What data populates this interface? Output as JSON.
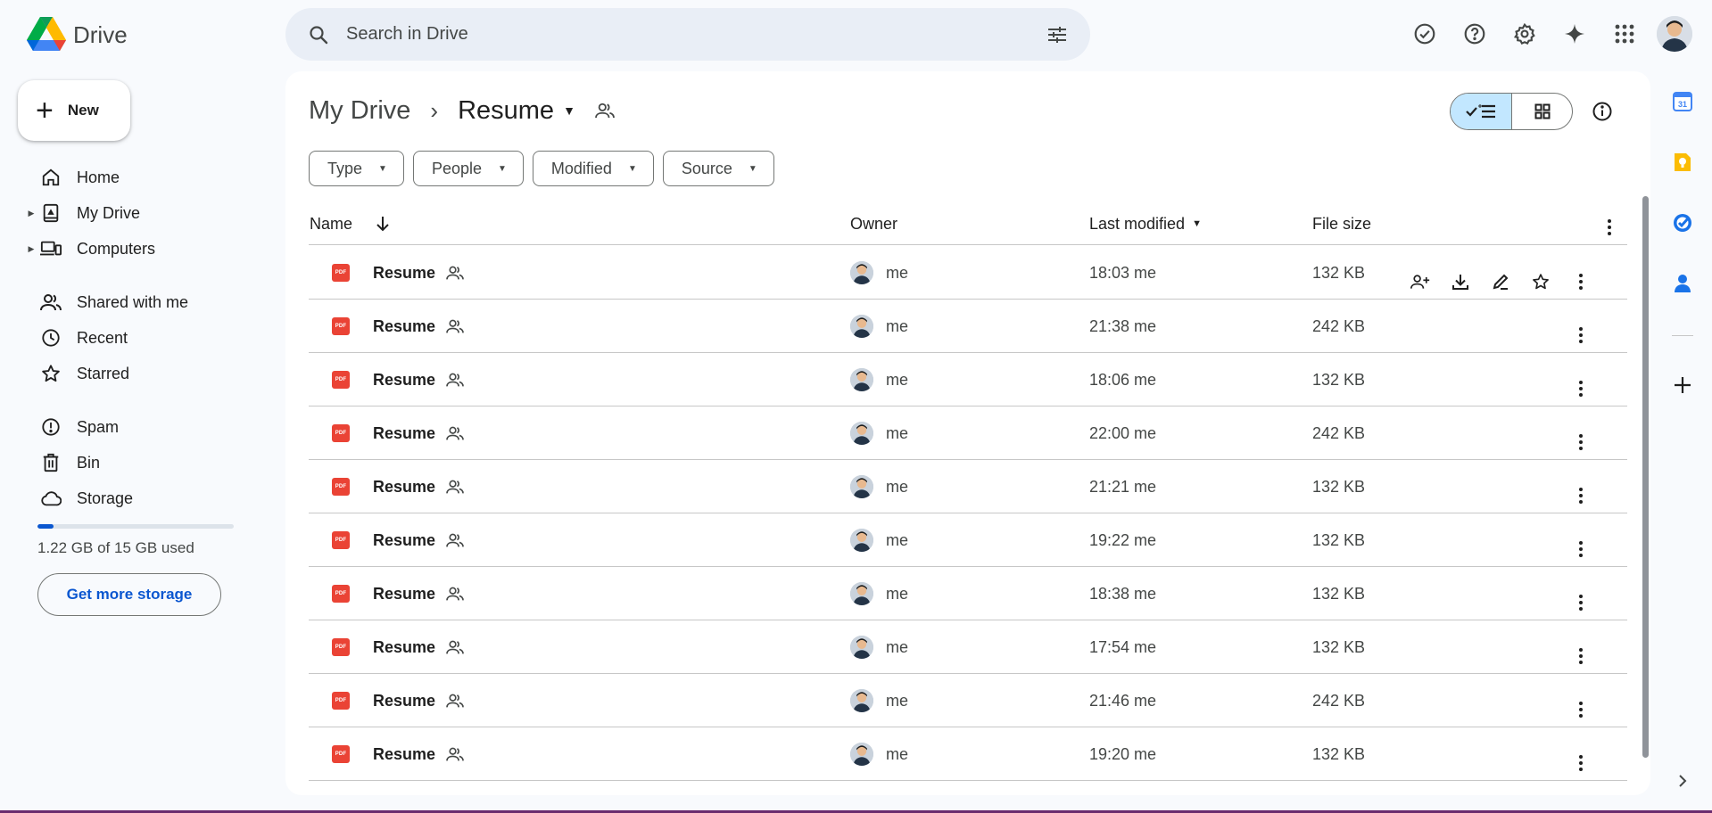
{
  "app": {
    "name": "Drive"
  },
  "search": {
    "placeholder": "Search in Drive"
  },
  "sidebar": {
    "new_label": "New",
    "items": [
      {
        "label": "Home"
      },
      {
        "label": "My Drive"
      },
      {
        "label": "Computers"
      },
      {
        "label": "Shared with me"
      },
      {
        "label": "Recent"
      },
      {
        "label": "Starred"
      },
      {
        "label": "Spam"
      },
      {
        "label": "Bin"
      },
      {
        "label": "Storage"
      }
    ],
    "storage": {
      "used_text": "1.22 GB of 15 GB used",
      "used_fraction": 0.081,
      "button_label": "Get more storage"
    }
  },
  "breadcrumb": {
    "root": "My Drive",
    "current": "Resume"
  },
  "filters": [
    "Type",
    "People",
    "Modified",
    "Source"
  ],
  "table": {
    "headers": {
      "name": "Name",
      "owner": "Owner",
      "modified": "Last modified",
      "size": "File size"
    },
    "rows": [
      {
        "name": "Resume",
        "owner": "me",
        "modified": "18:03 me",
        "size": "132 KB"
      },
      {
        "name": "Resume",
        "owner": "me",
        "modified": "21:38 me",
        "size": "242 KB"
      },
      {
        "name": "Resume",
        "owner": "me",
        "modified": "18:06 me",
        "size": "132 KB"
      },
      {
        "name": "Resume",
        "owner": "me",
        "modified": "22:00 me",
        "size": "242 KB"
      },
      {
        "name": "Resume",
        "owner": "me",
        "modified": "21:21 me",
        "size": "132 KB"
      },
      {
        "name": "Resume",
        "owner": "me",
        "modified": "19:22 me",
        "size": "132 KB"
      },
      {
        "name": "Resume",
        "owner": "me",
        "modified": "18:38 me",
        "size": "132 KB"
      },
      {
        "name": "Resume",
        "owner": "me",
        "modified": "17:54 me",
        "size": "132 KB"
      },
      {
        "name": "Resume",
        "owner": "me",
        "modified": "21:46 me",
        "size": "242 KB"
      },
      {
        "name": "Resume",
        "owner": "me",
        "modified": "19:20 me",
        "size": "132 KB"
      }
    ]
  },
  "rail": {
    "calendar_day": "31"
  },
  "colors": {
    "accent": "#0b57d0",
    "selected_view": "#c2e7ff",
    "pdf": "#ea4335"
  }
}
